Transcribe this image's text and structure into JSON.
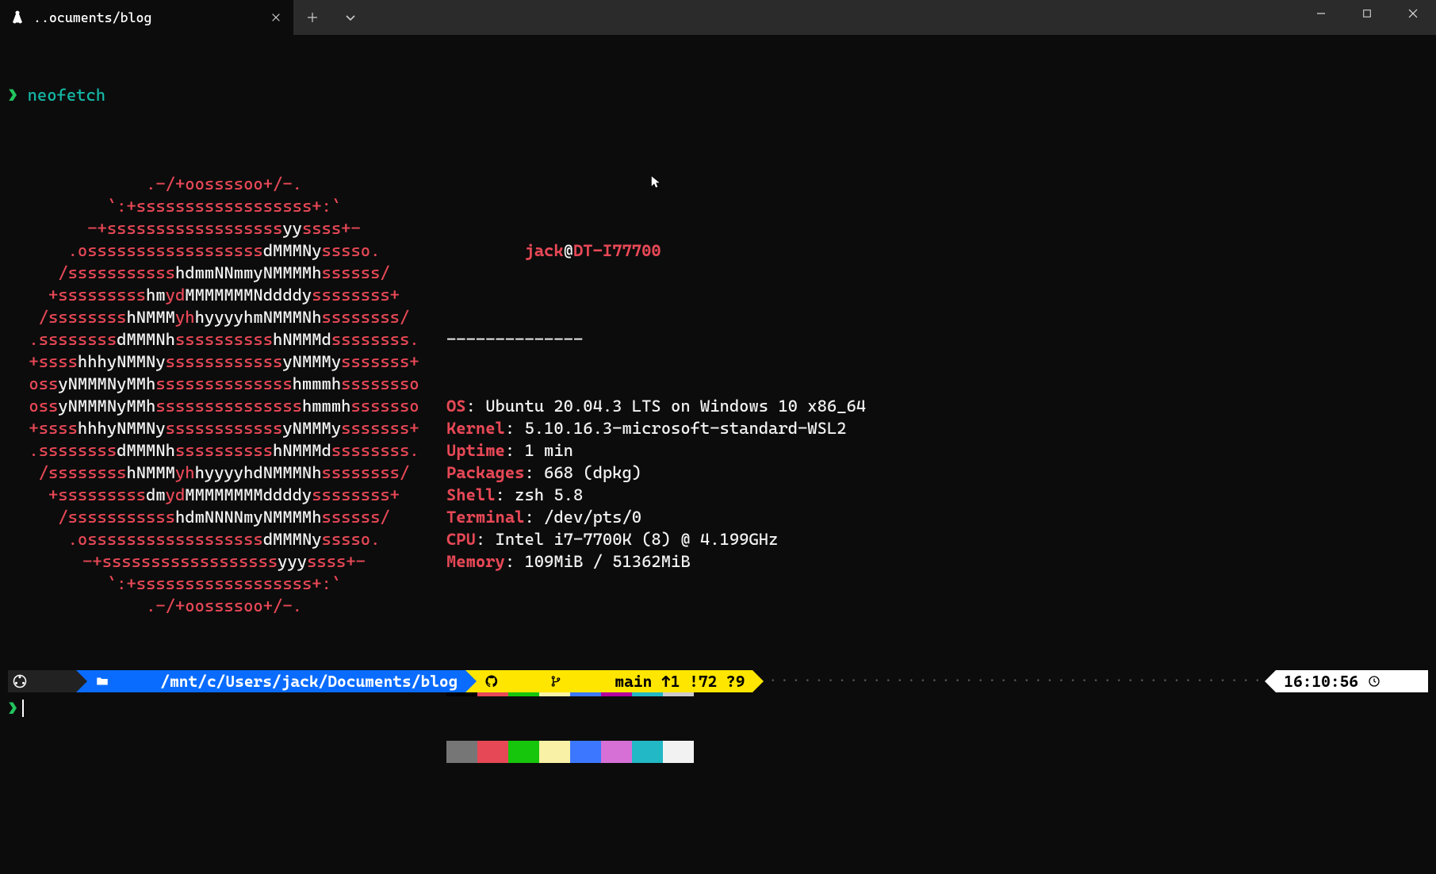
{
  "window": {
    "tab_title": "..ocuments/blog"
  },
  "prompt": {
    "symbol": "❯",
    "command": "neofetch"
  },
  "ascii": [
    [
      [
        "red",
        ".-/+oossssoo+/-."
      ]
    ],
    [
      [
        "red",
        "`:+ssssssssssssssssss+:`"
      ]
    ],
    [
      [
        "red",
        "-+ssssssssssssssssss"
      ],
      [
        "wht",
        "yy"
      ],
      [
        "red",
        "ssss+-"
      ]
    ],
    [
      [
        "red",
        ".ossssssssssssssssss"
      ],
      [
        "wht",
        "dMMMNy"
      ],
      [
        "red",
        "sssso."
      ]
    ],
    [
      [
        "red",
        "/sssssssssss"
      ],
      [
        "wht",
        "hdmmNNmmyNMMMMh"
      ],
      [
        "red",
        "ssssss/"
      ]
    ],
    [
      [
        "red",
        "+sssssssss"
      ],
      [
        "wht",
        "hm"
      ],
      [
        "red",
        "yd"
      ],
      [
        "wht",
        "MMMMMMMNddddy"
      ],
      [
        "red",
        "ssssssss+"
      ]
    ],
    [
      [
        "red",
        "/ssssssss"
      ],
      [
        "wht",
        "hNMMM"
      ],
      [
        "red",
        "yh"
      ],
      [
        "wht",
        "hyyyyhmNMMMNh"
      ],
      [
        "red",
        "ssssssss/"
      ]
    ],
    [
      [
        "red",
        ".ssssssss"
      ],
      [
        "wht",
        "dMMMNh"
      ],
      [
        "red",
        "ssssssssss"
      ],
      [
        "wht",
        "hNMMMd"
      ],
      [
        "red",
        "ssssssss."
      ]
    ],
    [
      [
        "red",
        "+ssss"
      ],
      [
        "wht",
        "hhhyNMMNy"
      ],
      [
        "red",
        "ssssssssssss"
      ],
      [
        "wht",
        "yNMMMy"
      ],
      [
        "red",
        "sssssss+"
      ]
    ],
    [
      [
        "red",
        "oss"
      ],
      [
        "wht",
        "yNMMMNyMMh"
      ],
      [
        "red",
        "ssssssssssssss"
      ],
      [
        "wht",
        "hmmmh"
      ],
      [
        "red",
        "ssssssso"
      ]
    ],
    [
      [
        "red",
        "oss"
      ],
      [
        "wht",
        "yNMMMNyMMh"
      ],
      [
        "red",
        "sssssssssssssss"
      ],
      [
        "wht",
        "hmmmh"
      ],
      [
        "red",
        "sssssso"
      ]
    ],
    [
      [
        "red",
        "+ssss"
      ],
      [
        "wht",
        "hhhyNMMNy"
      ],
      [
        "red",
        "ssssssssssss"
      ],
      [
        "wht",
        "yNMMMy"
      ],
      [
        "red",
        "sssssss+"
      ]
    ],
    [
      [
        "red",
        ".ssssssss"
      ],
      [
        "wht",
        "dMMMNh"
      ],
      [
        "red",
        "ssssssssss"
      ],
      [
        "wht",
        "hNMMMd"
      ],
      [
        "red",
        "ssssssss."
      ]
    ],
    [
      [
        "red",
        "/ssssssss"
      ],
      [
        "wht",
        "hNMMM"
      ],
      [
        "red",
        "yh"
      ],
      [
        "wht",
        "hyyyyhdNMMMNh"
      ],
      [
        "red",
        "ssssssss/"
      ]
    ],
    [
      [
        "red",
        "+sssssssss"
      ],
      [
        "wht",
        "dm"
      ],
      [
        "red",
        "yd"
      ],
      [
        "wht",
        "MMMMMMMMddddy"
      ],
      [
        "red",
        "ssssssss+"
      ]
    ],
    [
      [
        "red",
        "/sssssssssss"
      ],
      [
        "wht",
        "hdmNNNNmyNMMMMh"
      ],
      [
        "red",
        "ssssss/"
      ]
    ],
    [
      [
        "red",
        ".ossssssssssssssssss"
      ],
      [
        "wht",
        "dMMMNy"
      ],
      [
        "red",
        "sssso."
      ]
    ],
    [
      [
        "red",
        "-+ssssssssssssssssss"
      ],
      [
        "wht",
        "yyy"
      ],
      [
        "red",
        "ssss+-"
      ]
    ],
    [
      [
        "red",
        "`:+ssssssssssssssssss+:`"
      ]
    ],
    [
      [
        "red",
        ".-/+oossssoo+/-."
      ]
    ]
  ],
  "info": {
    "user": "jack",
    "at": "@",
    "host": "DT-I77700",
    "sep": "--------------",
    "lines": [
      {
        "k": "OS",
        "v": "Ubuntu 20.04.3 LTS on Windows 10 x86_64"
      },
      {
        "k": "Kernel",
        "v": "5.10.16.3-microsoft-standard-WSL2"
      },
      {
        "k": "Uptime",
        "v": "1 min"
      },
      {
        "k": "Packages",
        "v": "668 (dpkg)"
      },
      {
        "k": "Shell",
        "v": "zsh 5.8"
      },
      {
        "k": "Terminal",
        "v": "/dev/pts/0"
      },
      {
        "k": "CPU",
        "v": "Intel i7-7700K (8) @ 4.199GHz"
      },
      {
        "k": "Memory",
        "v": "109MiB / 51362MiB"
      }
    ]
  },
  "palette": {
    "row1": [
      "#000000",
      "#e74856",
      "#16c60c",
      "#f9f1a5",
      "#3b78ff",
      "#b4009e",
      "#22b8c6",
      "#cccccc"
    ],
    "row2": [
      "#767676",
      "#e74856",
      "#16c60c",
      "#f9f1a5",
      "#3b78ff",
      "#d670d6",
      "#22b8c6",
      "#f2f2f2"
    ]
  },
  "status": {
    "os_icon": "ubuntu",
    "folder_icon": "folder",
    "path": "/mnt/c/Users/jack/Documents/blog",
    "git_icon": "github",
    "branch_icon": "branch",
    "branch": "main",
    "ahead": "↑1",
    "dirty": "!72",
    "untracked": "?9",
    "time": "16:10:56",
    "clock_icon": "clock"
  }
}
